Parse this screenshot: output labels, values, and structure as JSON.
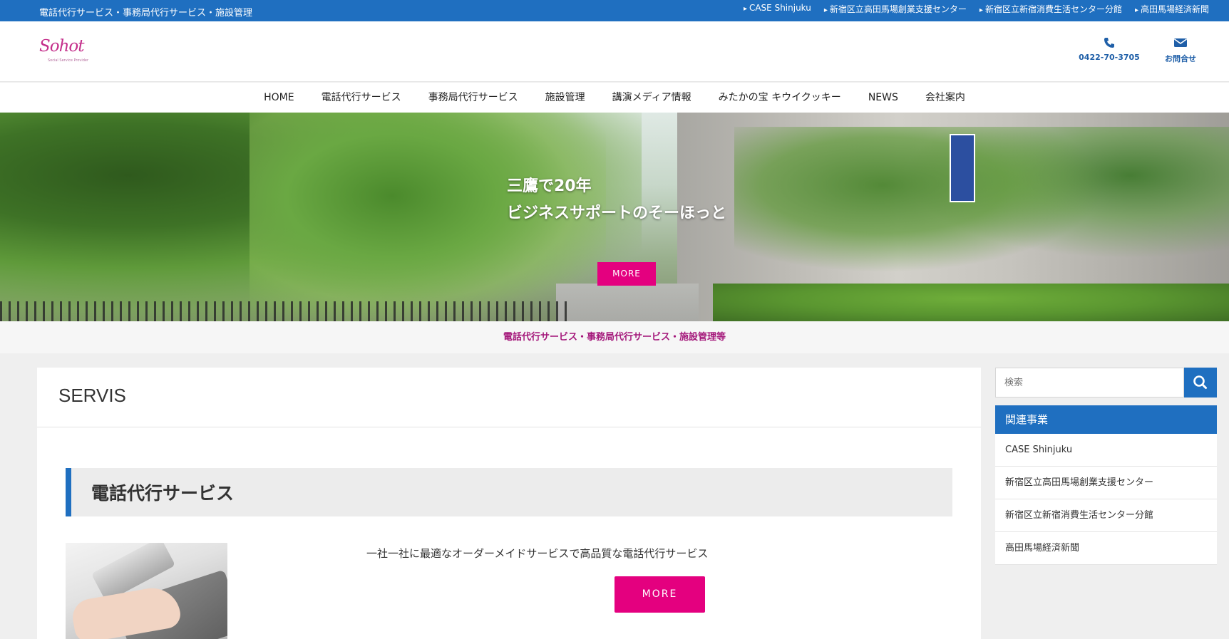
{
  "topbar": {
    "tagline": "電話代行サービス・事務局代行サービス・施設管理",
    "links": [
      "CASE Shinjuku",
      "新宿区立高田馬場創業支援センター",
      "新宿区立新宿消費生活センター分館",
      "高田馬場経済新聞"
    ]
  },
  "header": {
    "logo_text": "Sohot",
    "logo_sub": "Social Service Provider",
    "phone": "0422-70-3705",
    "contact_label": "お問合せ"
  },
  "nav": [
    "HOME",
    "電話代行サービス",
    "事務局代行サービス",
    "施設管理",
    "講演メディア情報",
    "みたかの宝 キウイクッキー",
    "NEWS",
    "会社案内"
  ],
  "hero": {
    "line1": "三鷹で20年",
    "line2": "ビジネスサポートのそーほっと",
    "more": "MORE"
  },
  "subtitle": "電話代行サービス・事務局代行サービス・施設管理等",
  "main": {
    "title": "SERVIS",
    "section_title": "電話代行サービス",
    "description": "一社一社に最適なオーダーメイドサービスで高品質な電話代行サービス",
    "more": "MORE"
  },
  "sidebar": {
    "search_placeholder": "検索",
    "related_title": "関連事業",
    "related_items": [
      "CASE Shinjuku",
      "新宿区立高田馬場創業支援センター",
      "新宿区立新宿消費生活センター分館",
      "高田馬場経済新聞"
    ]
  },
  "colors": {
    "brand_blue": "#1f6fc0",
    "accent_pink": "#e4007f",
    "subtitle_purple": "#a4177a"
  }
}
